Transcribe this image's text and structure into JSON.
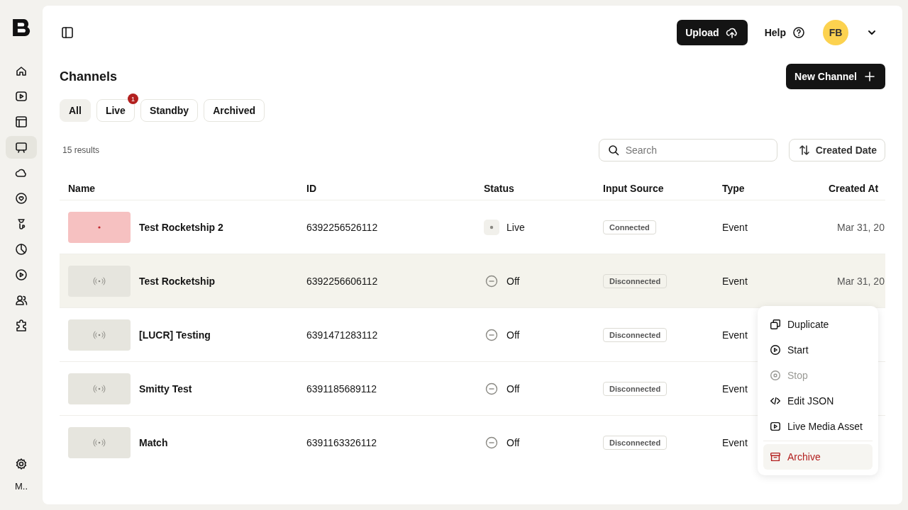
{
  "sidebar": {
    "items": [
      {
        "selected": false
      },
      {
        "selected": false
      },
      {
        "selected": false
      },
      {
        "selected": true
      },
      {
        "selected": false
      },
      {
        "selected": false
      },
      {
        "selected": false
      },
      {
        "selected": false
      },
      {
        "selected": false
      },
      {
        "selected": false
      },
      {
        "selected": false
      }
    ],
    "footer_label": "M.."
  },
  "header": {
    "upload": "Upload",
    "help": "Help",
    "avatar": "FB"
  },
  "page": {
    "title": "Channels",
    "new_button": "New Channel"
  },
  "filters": [
    {
      "label": "All",
      "selected": true
    },
    {
      "label": "Live",
      "selected": false,
      "badge": "1"
    },
    {
      "label": "Standby",
      "selected": false
    },
    {
      "label": "Archived",
      "selected": false
    }
  ],
  "results": "15 results",
  "search": {
    "placeholder": "Search"
  },
  "sort": {
    "label": "Created Date"
  },
  "table": {
    "columns": [
      "Name",
      "ID",
      "Status",
      "Input Source",
      "Type",
      "Created At"
    ],
    "rows": [
      {
        "name": "Test Rocketship 2",
        "id": "6392256526112",
        "status": "Live",
        "kind": "live",
        "input": "Connected",
        "type": "Event",
        "created": "Mar 31, 20",
        "selected": false
      },
      {
        "name": "Test Rocketship",
        "id": "6392256606112",
        "status": "Off",
        "kind": "off",
        "input": "Disconnected",
        "type": "Event",
        "created": "Mar 31, 20",
        "selected": true
      },
      {
        "name": "[LUCR] Testing",
        "id": "6391471283112",
        "status": "Off",
        "kind": "off",
        "input": "Disconnected",
        "type": "Event",
        "selected": false
      },
      {
        "name": "Smitty Test",
        "id": "6391185689112",
        "status": "Off",
        "kind": "off",
        "input": "Disconnected",
        "type": "Event",
        "selected": false
      },
      {
        "name": "Match",
        "id": "6391163326112",
        "status": "Off",
        "kind": "off",
        "input": "Disconnected",
        "type": "Event",
        "selected": false
      }
    ]
  },
  "menu": {
    "items": [
      {
        "label": "Duplicate",
        "kind": "normal",
        "disabled": false,
        "selected": false
      },
      {
        "label": "Start",
        "kind": "normal",
        "disabled": false,
        "selected": false
      },
      {
        "label": "Stop",
        "kind": "normal",
        "disabled": true,
        "selected": false
      },
      {
        "label": "Edit JSON",
        "kind": "normal",
        "disabled": false,
        "selected": false
      },
      {
        "label": "Live Media Asset",
        "kind": "normal",
        "disabled": false,
        "selected": false
      },
      {
        "label": "Archive",
        "kind": "danger",
        "disabled": false,
        "selected": true
      }
    ]
  }
}
